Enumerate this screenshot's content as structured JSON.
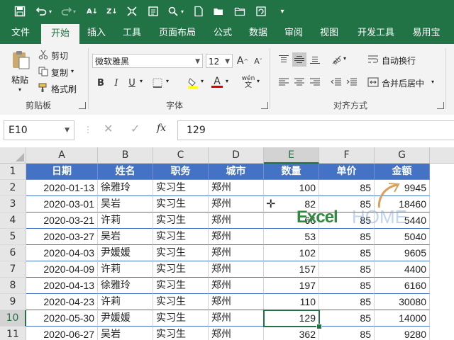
{
  "qat": {
    "icons": [
      "save-icon",
      "undo-icon",
      "redo-icon",
      "sort-ascending-icon",
      "sort-descending-icon",
      "fit-icon",
      "form-icon",
      "search-icon",
      "new-file-icon",
      "open-folder-icon",
      "folder-icon",
      "refresh-icon",
      "customize-icon"
    ]
  },
  "tabs": [
    "文件",
    "开始",
    "插入",
    "工具",
    "页面布局",
    "公式",
    "数据",
    "审阅",
    "视图",
    "开发工具",
    "易用宝",
    "⋯"
  ],
  "active_tab": "开始",
  "ribbon": {
    "clipboard": {
      "paste": "粘贴",
      "cut": "剪切",
      "copy": "复制",
      "format_painter": "格式刷",
      "label": "剪贴板"
    },
    "font": {
      "name": "微软雅黑",
      "size": "12",
      "grow": "A",
      "shrink": "A",
      "bold": "B",
      "italic": "I",
      "underline": "U",
      "font_color": "A",
      "phonetic": "wén",
      "label": "字体"
    },
    "alignment": {
      "wrap_text": "自动换行",
      "merge_center": "合并后居中",
      "label": "对齐方式"
    }
  },
  "formula_bar": {
    "name_box": "E10",
    "fx": "fx",
    "value": "129"
  },
  "columns": [
    "A",
    "B",
    "C",
    "D",
    "E",
    "F",
    "G"
  ],
  "selected_column": "E",
  "selected_row": "10",
  "rows": [
    "1",
    "2",
    "3",
    "4",
    "5",
    "6",
    "7",
    "8",
    "9",
    "10",
    "11"
  ],
  "header": [
    "日期",
    "姓名",
    "职务",
    "城市",
    "数量",
    "单价",
    "金额"
  ],
  "data": [
    [
      "2020-01-13",
      "徐雅玲",
      "实习生",
      "郑州",
      "100",
      "85",
      "9945"
    ],
    [
      "2020-03-01",
      "吴岩",
      "实习生",
      "郑州",
      "82",
      "85",
      "18460"
    ],
    [
      "2020-03-21",
      "许莉",
      "实习生",
      "郑州",
      "66",
      "85",
      "5440"
    ],
    [
      "2020-03-27",
      "吴岩",
      "实习生",
      "郑州",
      "53",
      "85",
      "5040"
    ],
    [
      "2020-04-03",
      "尹媛媛",
      "实习生",
      "郑州",
      "102",
      "85",
      "9605"
    ],
    [
      "2020-04-09",
      "许莉",
      "实习生",
      "郑州",
      "157",
      "85",
      "4400"
    ],
    [
      "2020-04-13",
      "徐雅玲",
      "实习生",
      "郑州",
      "197",
      "85",
      "6160"
    ],
    [
      "2020-04-23",
      "许莉",
      "实习生",
      "郑州",
      "110",
      "85",
      "30080"
    ],
    [
      "2020-05-30",
      "尹媛媛",
      "实习生",
      "郑州",
      "129",
      "85",
      "14000"
    ],
    [
      "2020-06-27",
      "吴岩",
      "实习生",
      "郑州",
      "362",
      "85",
      "9280"
    ]
  ],
  "watermark": {
    "excel": "Excel",
    "home": "HOME"
  },
  "colors": {
    "accent": "#217346",
    "table_header": "#4472c4",
    "table_border": "#4472c4"
  }
}
